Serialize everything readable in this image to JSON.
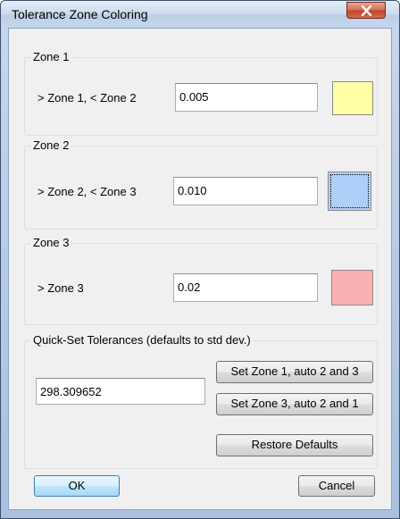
{
  "window": {
    "title": "Tolerance Zone Coloring"
  },
  "zone1": {
    "legend": "Zone 1",
    "label": "> Zone 1, < Zone 2",
    "value": "0.005",
    "color": "#ffffa8"
  },
  "zone2": {
    "legend": "Zone 2",
    "label": "> Zone 2, < Zone 3",
    "value": "0.010",
    "color": "#aed0f8"
  },
  "zone3": {
    "legend": "Zone 3",
    "label": "> Zone 3",
    "value": "0.02",
    "color": "#f8b0b0"
  },
  "quickset": {
    "legend": "Quick-Set Tolerances (defaults to std dev.)",
    "value": "298.309652",
    "btn_zone1": "Set Zone 1, auto 2 and 3",
    "btn_zone3": "Set Zone 3, auto 2 and 1",
    "btn_restore": "Restore Defaults"
  },
  "footer": {
    "ok_label": "OK",
    "cancel_label": "Cancel"
  },
  "icons": {
    "close": "close-icon"
  }
}
